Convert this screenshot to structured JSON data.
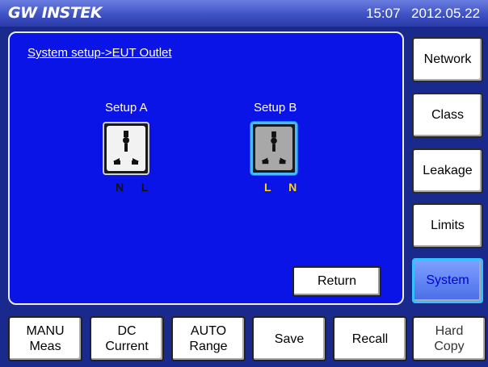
{
  "header": {
    "brand": "GW INSTEK",
    "time": "15:07",
    "date": "2012.05.22"
  },
  "main": {
    "breadcrumb": "System setup->EUT Outlet",
    "setup_a": {
      "label": "Setup A",
      "pin_left": "N",
      "pin_right": "L"
    },
    "setup_b": {
      "label": "Setup B",
      "pin_left": "L",
      "pin_right": "N",
      "selected": true
    },
    "return_label": "Return"
  },
  "sidebar": {
    "items": [
      {
        "label": "Network"
      },
      {
        "label": "Class"
      },
      {
        "label": "Leakage"
      },
      {
        "label": "Limits"
      },
      {
        "label": "System",
        "active": true
      }
    ]
  },
  "bottom": {
    "buttons": [
      {
        "line1": "MANU",
        "line2": "Meas"
      },
      {
        "line1": "DC",
        "line2": "Current"
      },
      {
        "line1": "AUTO",
        "line2": "Range"
      },
      {
        "line1": "Save",
        "line2": ""
      },
      {
        "line1": "Recall",
        "line2": ""
      },
      {
        "line1": "Hard",
        "line2": "Copy"
      }
    ]
  },
  "colors": {
    "panel": "#0a14e6",
    "frame": "#1a2a8c",
    "pin_label": "#ffd700",
    "selected_border": "#48b8ff"
  }
}
